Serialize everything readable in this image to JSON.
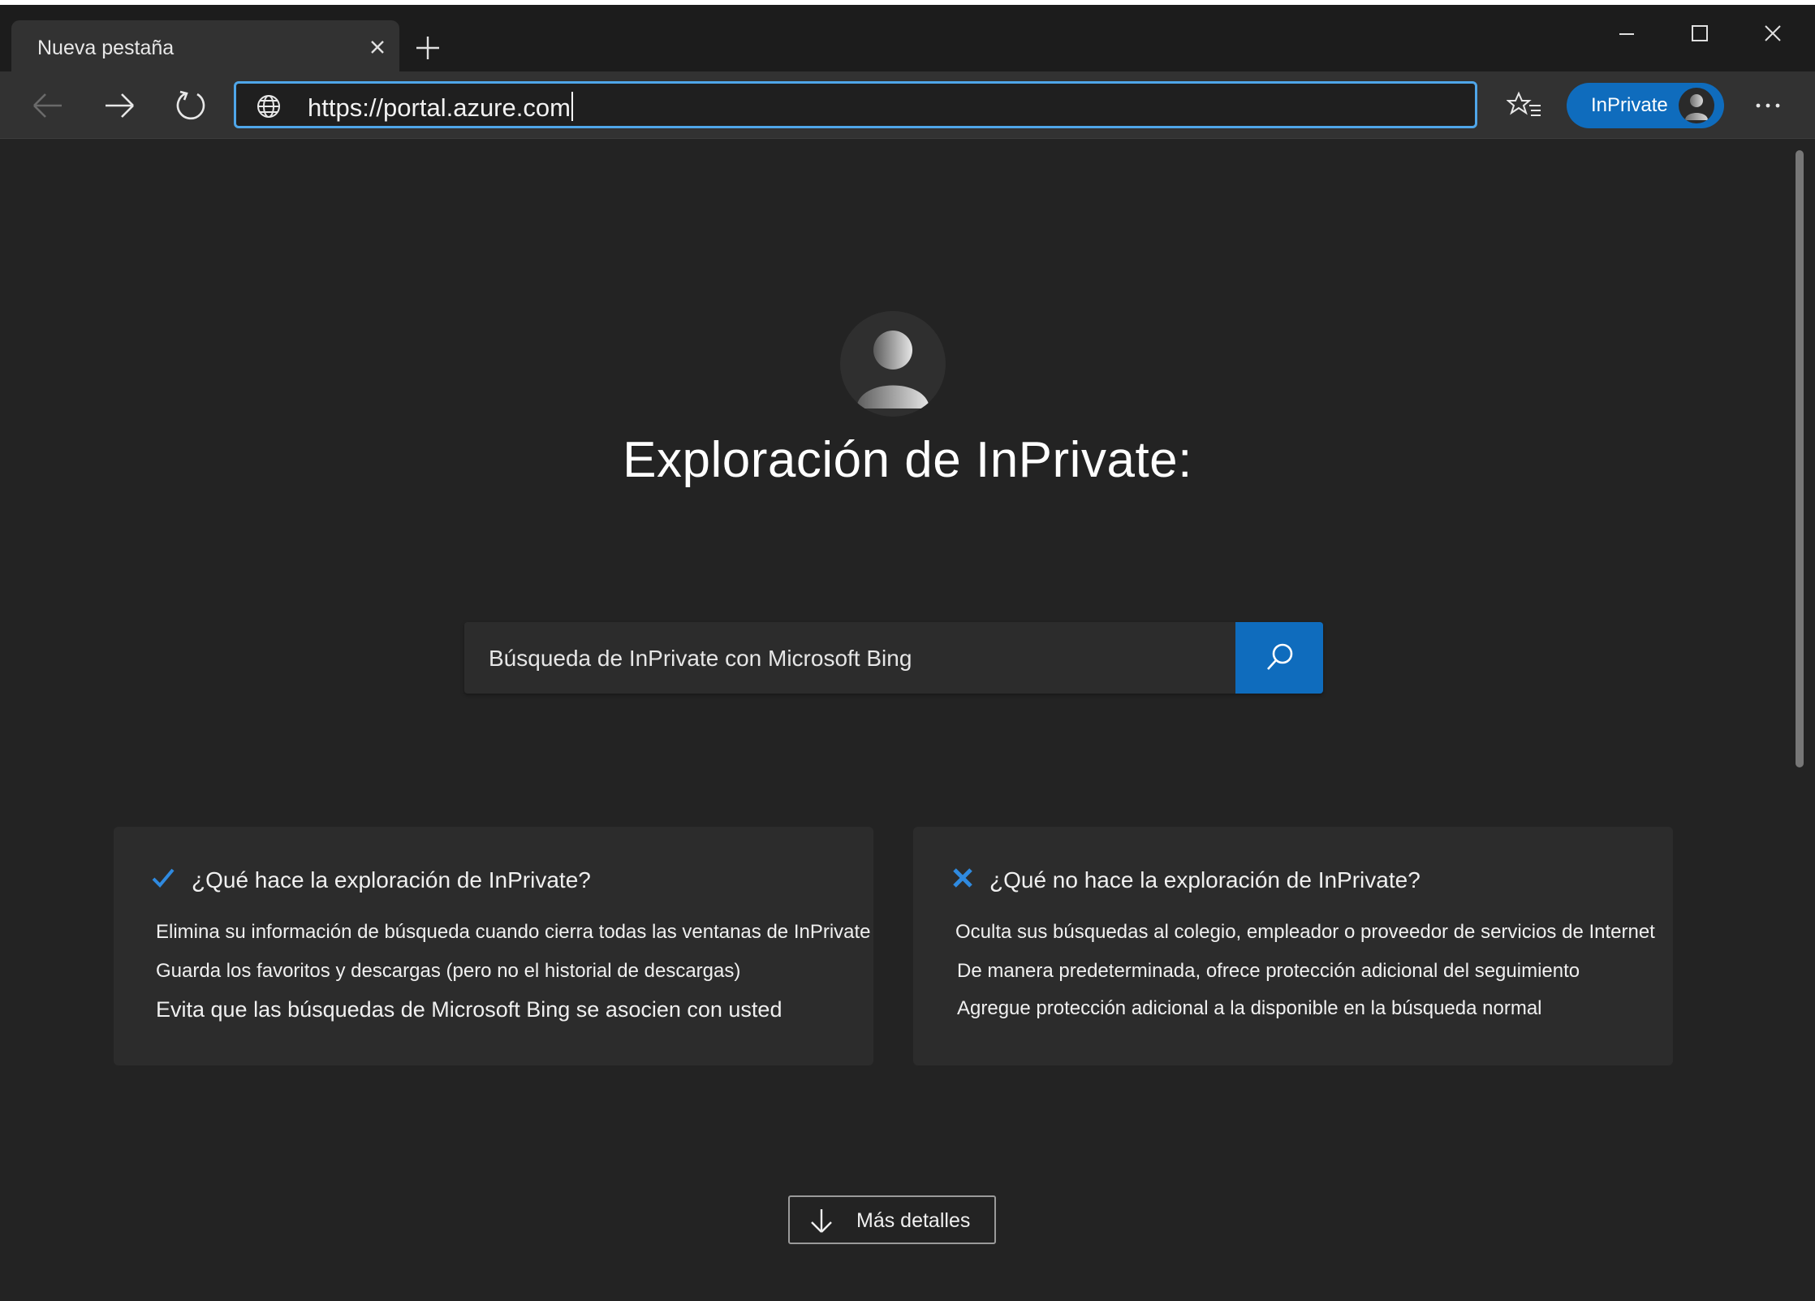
{
  "tab": {
    "title": "Nueva pestaña"
  },
  "address_bar": {
    "url": "https://portal.azure.com"
  },
  "profile_button": {
    "label": "InPrivate"
  },
  "page": {
    "title": "Exploración de InPrivate:",
    "search_text": "Búsqueda de InPrivate con Microsoft Bing"
  },
  "cards": {
    "does": {
      "heading": "¿Qué hace la exploración de InPrivate?",
      "items": [
        "Elimina su información de búsqueda cuando cierra todas las ventanas de InPrivate",
        "Guarda los favoritos y descargas (pero no el historial de descargas)",
        "Evita que las búsquedas de Microsoft Bing se asocien con usted"
      ]
    },
    "does_not": {
      "heading": "¿Qué no hace la exploración de InPrivate?",
      "items": [
        "Oculta sus búsquedas al colegio, empleador o proveedor de servicios de Internet",
        "De manera predeterminada, ofrece protección adicional del seguimiento",
        "Agregue protección adicional a la disponible en la búsqueda normal"
      ]
    }
  },
  "details_button": {
    "label": "Más detalles"
  },
  "colors": {
    "accent": "#0f6cbd",
    "address_focus": "#4fa6e9",
    "background": "#232323",
    "card": "#2c2c2c"
  },
  "icons": [
    "close-icon",
    "plus-icon",
    "minimize-icon",
    "maximize-icon",
    "back-arrow-icon",
    "forward-arrow-icon",
    "refresh-icon",
    "globe-icon",
    "favorites-icon",
    "avatar-icon",
    "more-icon",
    "search-icon",
    "checkmark-icon",
    "x-mark-icon",
    "arrow-down-icon"
  ]
}
